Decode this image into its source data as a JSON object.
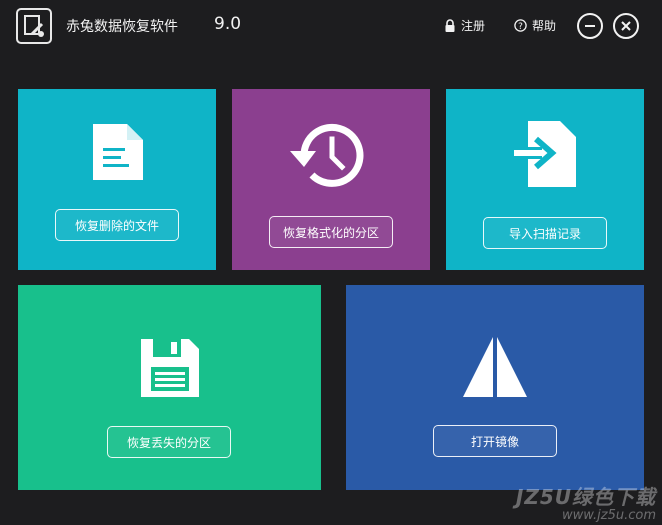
{
  "app": {
    "title": "赤兔数据恢复软件",
    "version": "9.0",
    "logo_icon": "app-logo-icon"
  },
  "titlebar": {
    "register_label": "注册",
    "register_icon": "lock-icon",
    "help_label": "帮助",
    "help_icon": "help-icon",
    "minimize_icon": "minimize-icon",
    "close_icon": "close-icon"
  },
  "tiles": [
    {
      "label": "恢复删除的文件",
      "icon": "document-icon",
      "color": "#0fb4c7"
    },
    {
      "label": "恢复格式化的分区",
      "icon": "history-clock-icon",
      "color": "#8b3f8f"
    },
    {
      "label": "导入扫描记录",
      "icon": "import-file-icon",
      "color": "#0fb4c7"
    },
    {
      "label": "恢复丢失的分区",
      "icon": "floppy-disk-icon",
      "color": "#18c08c"
    },
    {
      "label": "打开镜像",
      "icon": "image-sail-icon",
      "color": "#2a5aa7"
    }
  ],
  "watermark": {
    "line1": "JZ5U绿色下载",
    "line2": "www.jz5u.com"
  }
}
